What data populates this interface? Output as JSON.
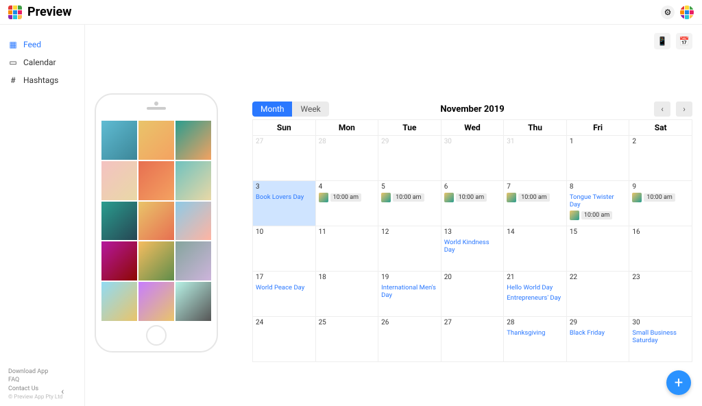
{
  "brand": {
    "name": "Preview"
  },
  "sidebar": {
    "items": [
      {
        "label": "Feed",
        "icon": "grid-icon",
        "active": true
      },
      {
        "label": "Calendar",
        "icon": "calendar-icon",
        "active": false
      },
      {
        "label": "Hashtags",
        "icon": "hashtag-icon",
        "active": false
      }
    ],
    "footer": {
      "links": [
        "Download App",
        "FAQ",
        "Contact Us"
      ],
      "copyright": "© Preview App Pty Ltd"
    }
  },
  "tools": {
    "phone": "phone-icon",
    "calendar": "calendar-icon",
    "settings": "gear-icon"
  },
  "calendar": {
    "title": "November 2019",
    "view_options": {
      "month": "Month",
      "week": "Week",
      "active": "month"
    },
    "weekdays": [
      "Sun",
      "Mon",
      "Tue",
      "Wed",
      "Thu",
      "Fri",
      "Sat"
    ],
    "selected_date": "2019-11-03",
    "weeks": [
      [
        {
          "num": 27,
          "other": true
        },
        {
          "num": 28,
          "other": true
        },
        {
          "num": 29,
          "other": true
        },
        {
          "num": 30,
          "other": true
        },
        {
          "num": 31,
          "other": true
        },
        {
          "num": 1
        },
        {
          "num": 2
        }
      ],
      [
        {
          "num": 3,
          "selected": true,
          "events": [
            "Book Lovers Day"
          ]
        },
        {
          "num": 4,
          "posts": [
            {
              "time": "10:00 am"
            }
          ]
        },
        {
          "num": 5,
          "posts": [
            {
              "time": "10:00 am"
            }
          ]
        },
        {
          "num": 6,
          "posts": [
            {
              "time": "10:00 am"
            }
          ]
        },
        {
          "num": 7,
          "posts": [
            {
              "time": "10:00 am"
            }
          ]
        },
        {
          "num": 8,
          "events": [
            "Tongue Twister Day"
          ],
          "posts": [
            {
              "time": "10:00 am"
            }
          ]
        },
        {
          "num": 9,
          "posts": [
            {
              "time": "10:00 am"
            }
          ]
        }
      ],
      [
        {
          "num": 10
        },
        {
          "num": 11
        },
        {
          "num": 12
        },
        {
          "num": 13,
          "events": [
            "World Kindness Day"
          ]
        },
        {
          "num": 14
        },
        {
          "num": 15
        },
        {
          "num": 16
        }
      ],
      [
        {
          "num": 17,
          "events": [
            "World Peace Day"
          ]
        },
        {
          "num": 18
        },
        {
          "num": 19,
          "events": [
            "International Men's Day"
          ]
        },
        {
          "num": 20
        },
        {
          "num": 21,
          "events": [
            "Hello World Day",
            "Entrepreneurs' Day"
          ]
        },
        {
          "num": 22
        },
        {
          "num": 23
        }
      ],
      [
        {
          "num": 24
        },
        {
          "num": 25
        },
        {
          "num": 26
        },
        {
          "num": 27
        },
        {
          "num": 28,
          "events": [
            "Thanksgiving"
          ]
        },
        {
          "num": 29,
          "events": [
            "Black Friday"
          ]
        },
        {
          "num": 30,
          "events": [
            "Small Business Saturday"
          ]
        }
      ]
    ]
  },
  "fab": {
    "label": "+"
  }
}
